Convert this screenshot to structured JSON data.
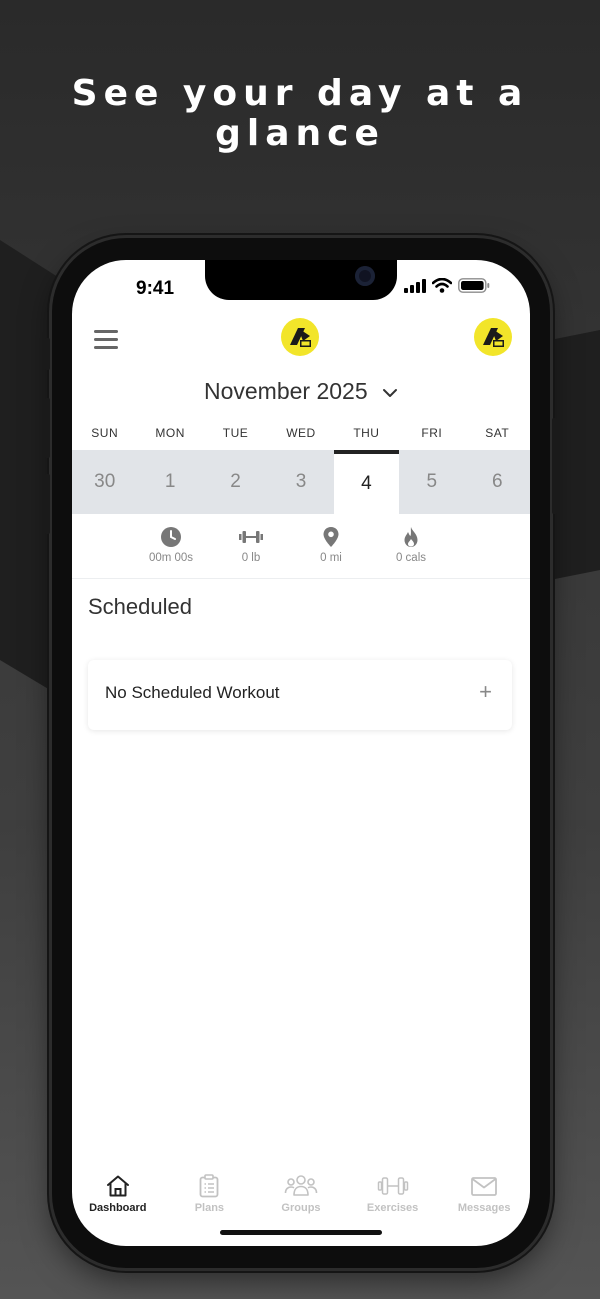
{
  "headline": "See your day at a glance",
  "status_bar": {
    "time": "9:41"
  },
  "header": {
    "month": "November 2025"
  },
  "week": {
    "days": [
      "SUN",
      "MON",
      "TUE",
      "WED",
      "THU",
      "FRI",
      "SAT"
    ],
    "dates": [
      "30",
      "1",
      "2",
      "3",
      "4",
      "5",
      "6"
    ],
    "selected_index": 4
  },
  "stats": [
    {
      "icon": "clock-icon",
      "value": "00m 00s"
    },
    {
      "icon": "dumbbell-icon",
      "value": "0 lb"
    },
    {
      "icon": "location-pin-icon",
      "value": "0 mi"
    },
    {
      "icon": "flame-icon",
      "value": "0 cals"
    }
  ],
  "scheduled": {
    "title": "Scheduled",
    "card_label": "No Scheduled Workout",
    "add_symbol": "+"
  },
  "tabs": [
    {
      "label": "Dashboard",
      "icon": "home-icon",
      "active": true
    },
    {
      "label": "Plans",
      "icon": "clipboard-icon",
      "active": false
    },
    {
      "label": "Groups",
      "icon": "group-icon",
      "active": false
    },
    {
      "label": "Exercises",
      "icon": "dumbbell-icon",
      "active": false
    },
    {
      "label": "Messages",
      "icon": "envelope-icon",
      "active": false
    }
  ],
  "colors": {
    "brand_yellow": "#f2e52a",
    "selected_day_bar": "#222222",
    "week_strip": "#e1e4e8",
    "inactive_tab": "#c2c2c2"
  }
}
